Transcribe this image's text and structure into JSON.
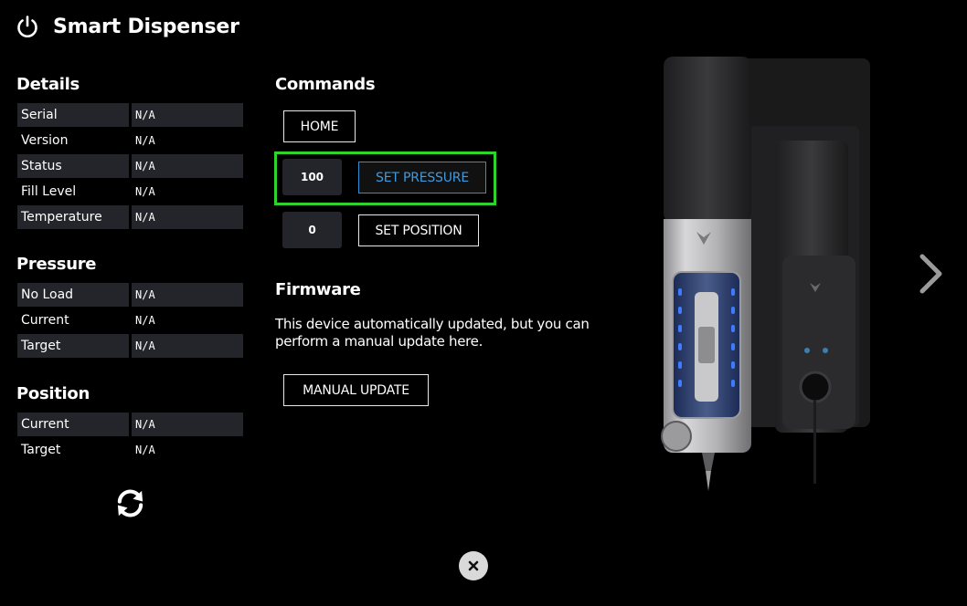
{
  "header": {
    "title": "Smart Dispenser",
    "power_icon": "power-icon"
  },
  "details": {
    "title": "Details",
    "rows": [
      {
        "label": "Serial",
        "value": "N/A"
      },
      {
        "label": "Version",
        "value": "N/A"
      },
      {
        "label": "Status",
        "value": "N/A"
      },
      {
        "label": "Fill Level",
        "value": "N/A"
      },
      {
        "label": "Temperature",
        "value": "N/A"
      }
    ]
  },
  "pressure": {
    "title": "Pressure",
    "rows": [
      {
        "label": "No Load",
        "value": "N/A"
      },
      {
        "label": "Current",
        "value": "N/A"
      },
      {
        "label": "Target",
        "value": "N/A"
      }
    ]
  },
  "position": {
    "title": "Position",
    "rows": [
      {
        "label": "Current",
        "value": "N/A"
      },
      {
        "label": "Target",
        "value": "N/A"
      }
    ]
  },
  "commands": {
    "title": "Commands",
    "home_label": "HOME",
    "pressure_value": "100",
    "set_pressure_label": "SET PRESSURE",
    "position_value": "0",
    "set_position_label": "SET POSITION"
  },
  "firmware": {
    "title": "Firmware",
    "description": "This device automatically updated, but you can perform a manual update here.",
    "manual_update_label": "MANUAL UPDATE"
  },
  "colors": {
    "highlight": "#2fd42a",
    "accent": "#2e8fd6",
    "panel": "#23252b"
  }
}
